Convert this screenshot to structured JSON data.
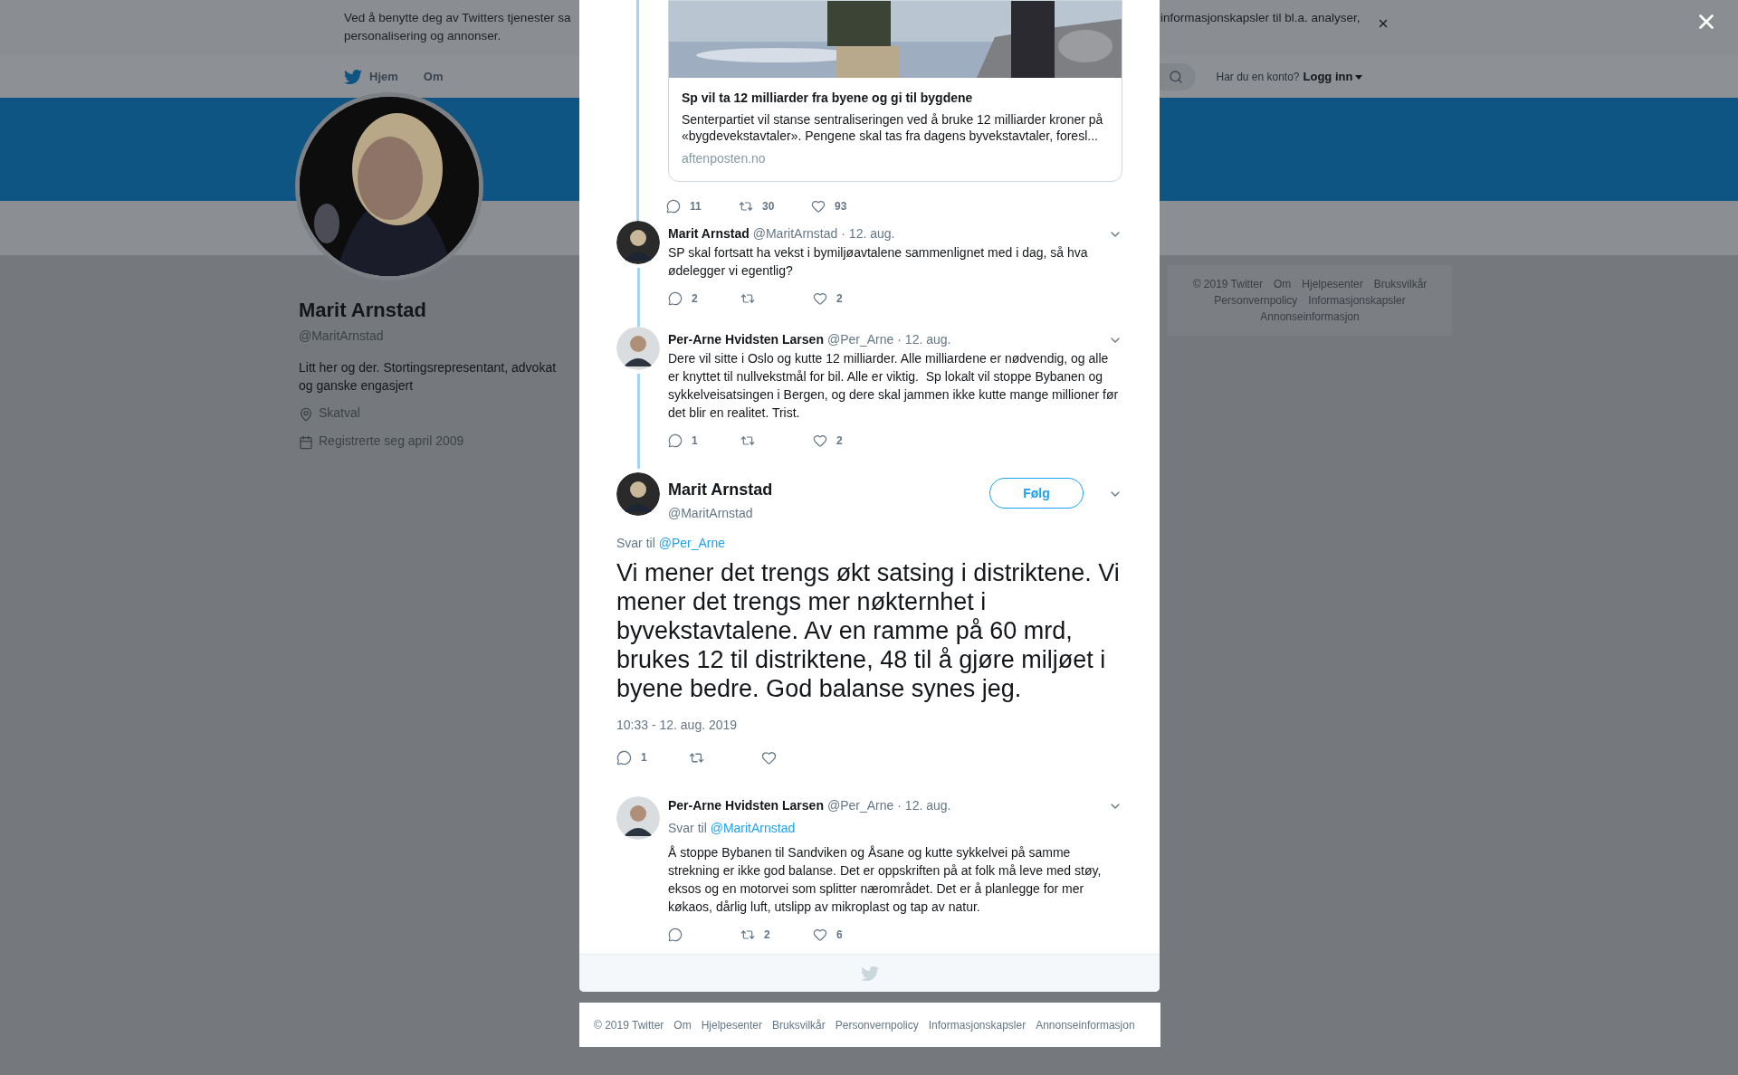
{
  "cookie_banner": {
    "text_start": "Ved å benytte deg av Twitters tjenester sa",
    "text_line2": "personalisering og annonser.",
    "text_end": "informasjonskapsler til bl.a. analyser,"
  },
  "nav": {
    "items": [
      {
        "label": "Hjem",
        "kind": "home"
      },
      {
        "label": "Om",
        "kind": "plain"
      }
    ],
    "login_prompt": "Har du en konto?",
    "login_link": "Logg inn"
  },
  "profile": {
    "name": "Marit Arnstad",
    "handle": "@MaritArnstad",
    "bio": "Litt her og der. Stortingsrepresentant, advokat og ganske engasjert",
    "location": "Skatval",
    "joined": "Registrerte seg april 2009"
  },
  "side_footer": {
    "links": [
      "© 2019 Twitter",
      "Om",
      "Hjelpesenter",
      "Bruksvilkår",
      "Personvernpolicy",
      "Informasjonskapsler",
      "Annonseinformasjon"
    ]
  },
  "modal": {
    "top_tweet_tail": {
      "card": {
        "title": "Sp vil ta 12 milliarder fra byene og gi til bygdene",
        "description": "Senterpartiet vil stanse sentraliseringen ved å bruke 12 milliarder kroner på «bygdevekstavtaler». Pengene skal tas fra dagens byvekstavtaler, foresl...",
        "domain": "aftenposten.no"
      },
      "actions": {
        "replies": "11",
        "retweets": "30",
        "likes": "93"
      }
    },
    "thread_tweets": [
      {
        "name": "Marit Arnstad",
        "handle": "@MaritArnstad",
        "date": "· 12. aug.",
        "text": "SP skal fortsatt ha vekst i bymiljøavtalene sammenlignet med i dag, så hva ødelegger vi egentlig?",
        "actions": {
          "replies": "2",
          "likes": "2"
        }
      },
      {
        "name": "Per-Arne Hvidsten Larsen",
        "handle": "@Per_Arne",
        "date": "· 12. aug.",
        "text": "Dere vil sitte i Oslo og kutte 12 milliarder. Alle milliardene er nødvendig, og alle er knyttet til nullvekstmål for bil. Alle er viktig.  Sp lokalt vil stoppe Bybanen og sykkelveisatsingen i Bergen, og dere skal jammen ikke kutte mange millioner før det blir en realitet. Trist.",
        "actions": {
          "replies": "1",
          "likes": "2"
        }
      }
    ],
    "focus_tweet": {
      "name": "Marit Arnstad",
      "handle": "@MaritArnstad",
      "follow_button": "Følg",
      "reply_label": "Svar til",
      "reply_to": "@Per_Arne",
      "text": "Vi mener det trengs økt satsing i distriktene. Vi mener det trengs mer nøkternhet i byvekstavtalene. Av en ramme på 60 mrd, brukes 12 til distriktene, 48 til å gjøre miljøet i byene bedre. God balanse synes jeg.",
      "timestamp": "10:33 - 12. aug. 2019",
      "actions": {
        "replies": "1"
      }
    },
    "replies": [
      {
        "name": "Per-Arne Hvidsten Larsen",
        "handle": "@Per_Arne",
        "date": "· 12. aug.",
        "reply_label": "Svar til",
        "reply_to": "@MaritArnstad",
        "text": "Å stoppe Bybanen til Sandviken og Åsane og kutte sykkelvei på samme strekning er ikke god balanse. Det er oppskriften på at folk må leve med støy, eksos og en motorvei som splitter nærområdet. Det er å planlegge for mer køkaos, dårlig luft, utslipp av mikroplast og tap av natur.",
        "actions": {
          "retweets": "2",
          "likes": "6"
        }
      }
    ]
  },
  "bottom_footer": {
    "links": [
      "© 2019 Twitter",
      "Om",
      "Hjelpesenter",
      "Bruksvilkår",
      "Personvernpolicy",
      "Informasjonskapsler",
      "Annonseinformasjon"
    ]
  }
}
